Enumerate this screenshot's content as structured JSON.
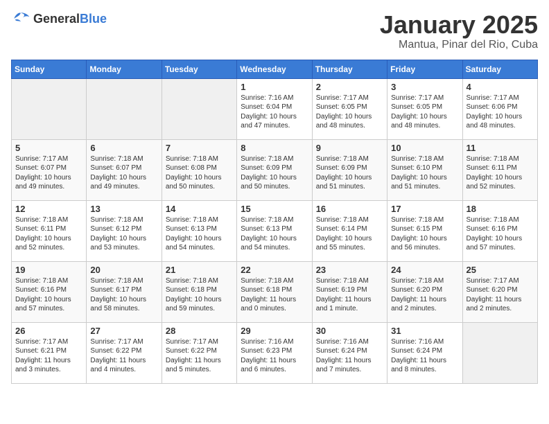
{
  "header": {
    "logo_general": "General",
    "logo_blue": "Blue",
    "month": "January 2025",
    "location": "Mantua, Pinar del Rio, Cuba"
  },
  "days_of_week": [
    "Sunday",
    "Monday",
    "Tuesday",
    "Wednesday",
    "Thursday",
    "Friday",
    "Saturday"
  ],
  "weeks": [
    [
      {
        "day": "",
        "empty": true
      },
      {
        "day": "",
        "empty": true
      },
      {
        "day": "",
        "empty": true
      },
      {
        "day": "1",
        "sunrise": "Sunrise: 7:16 AM",
        "sunset": "Sunset: 6:04 PM",
        "daylight": "Daylight: 10 hours and 47 minutes."
      },
      {
        "day": "2",
        "sunrise": "Sunrise: 7:17 AM",
        "sunset": "Sunset: 6:05 PM",
        "daylight": "Daylight: 10 hours and 48 minutes."
      },
      {
        "day": "3",
        "sunrise": "Sunrise: 7:17 AM",
        "sunset": "Sunset: 6:05 PM",
        "daylight": "Daylight: 10 hours and 48 minutes."
      },
      {
        "day": "4",
        "sunrise": "Sunrise: 7:17 AM",
        "sunset": "Sunset: 6:06 PM",
        "daylight": "Daylight: 10 hours and 48 minutes."
      }
    ],
    [
      {
        "day": "5",
        "sunrise": "Sunrise: 7:17 AM",
        "sunset": "Sunset: 6:07 PM",
        "daylight": "Daylight: 10 hours and 49 minutes."
      },
      {
        "day": "6",
        "sunrise": "Sunrise: 7:18 AM",
        "sunset": "Sunset: 6:07 PM",
        "daylight": "Daylight: 10 hours and 49 minutes."
      },
      {
        "day": "7",
        "sunrise": "Sunrise: 7:18 AM",
        "sunset": "Sunset: 6:08 PM",
        "daylight": "Daylight: 10 hours and 50 minutes."
      },
      {
        "day": "8",
        "sunrise": "Sunrise: 7:18 AM",
        "sunset": "Sunset: 6:09 PM",
        "daylight": "Daylight: 10 hours and 50 minutes."
      },
      {
        "day": "9",
        "sunrise": "Sunrise: 7:18 AM",
        "sunset": "Sunset: 6:09 PM",
        "daylight": "Daylight: 10 hours and 51 minutes."
      },
      {
        "day": "10",
        "sunrise": "Sunrise: 7:18 AM",
        "sunset": "Sunset: 6:10 PM",
        "daylight": "Daylight: 10 hours and 51 minutes."
      },
      {
        "day": "11",
        "sunrise": "Sunrise: 7:18 AM",
        "sunset": "Sunset: 6:11 PM",
        "daylight": "Daylight: 10 hours and 52 minutes."
      }
    ],
    [
      {
        "day": "12",
        "sunrise": "Sunrise: 7:18 AM",
        "sunset": "Sunset: 6:11 PM",
        "daylight": "Daylight: 10 hours and 52 minutes."
      },
      {
        "day": "13",
        "sunrise": "Sunrise: 7:18 AM",
        "sunset": "Sunset: 6:12 PM",
        "daylight": "Daylight: 10 hours and 53 minutes."
      },
      {
        "day": "14",
        "sunrise": "Sunrise: 7:18 AM",
        "sunset": "Sunset: 6:13 PM",
        "daylight": "Daylight: 10 hours and 54 minutes."
      },
      {
        "day": "15",
        "sunrise": "Sunrise: 7:18 AM",
        "sunset": "Sunset: 6:13 PM",
        "daylight": "Daylight: 10 hours and 54 minutes."
      },
      {
        "day": "16",
        "sunrise": "Sunrise: 7:18 AM",
        "sunset": "Sunset: 6:14 PM",
        "daylight": "Daylight: 10 hours and 55 minutes."
      },
      {
        "day": "17",
        "sunrise": "Sunrise: 7:18 AM",
        "sunset": "Sunset: 6:15 PM",
        "daylight": "Daylight: 10 hours and 56 minutes."
      },
      {
        "day": "18",
        "sunrise": "Sunrise: 7:18 AM",
        "sunset": "Sunset: 6:16 PM",
        "daylight": "Daylight: 10 hours and 57 minutes."
      }
    ],
    [
      {
        "day": "19",
        "sunrise": "Sunrise: 7:18 AM",
        "sunset": "Sunset: 6:16 PM",
        "daylight": "Daylight: 10 hours and 57 minutes."
      },
      {
        "day": "20",
        "sunrise": "Sunrise: 7:18 AM",
        "sunset": "Sunset: 6:17 PM",
        "daylight": "Daylight: 10 hours and 58 minutes."
      },
      {
        "day": "21",
        "sunrise": "Sunrise: 7:18 AM",
        "sunset": "Sunset: 6:18 PM",
        "daylight": "Daylight: 10 hours and 59 minutes."
      },
      {
        "day": "22",
        "sunrise": "Sunrise: 7:18 AM",
        "sunset": "Sunset: 6:18 PM",
        "daylight": "Daylight: 11 hours and 0 minutes."
      },
      {
        "day": "23",
        "sunrise": "Sunrise: 7:18 AM",
        "sunset": "Sunset: 6:19 PM",
        "daylight": "Daylight: 11 hours and 1 minute."
      },
      {
        "day": "24",
        "sunrise": "Sunrise: 7:18 AM",
        "sunset": "Sunset: 6:20 PM",
        "daylight": "Daylight: 11 hours and 2 minutes."
      },
      {
        "day": "25",
        "sunrise": "Sunrise: 7:17 AM",
        "sunset": "Sunset: 6:20 PM",
        "daylight": "Daylight: 11 hours and 2 minutes."
      }
    ],
    [
      {
        "day": "26",
        "sunrise": "Sunrise: 7:17 AM",
        "sunset": "Sunset: 6:21 PM",
        "daylight": "Daylight: 11 hours and 3 minutes."
      },
      {
        "day": "27",
        "sunrise": "Sunrise: 7:17 AM",
        "sunset": "Sunset: 6:22 PM",
        "daylight": "Daylight: 11 hours and 4 minutes."
      },
      {
        "day": "28",
        "sunrise": "Sunrise: 7:17 AM",
        "sunset": "Sunset: 6:22 PM",
        "daylight": "Daylight: 11 hours and 5 minutes."
      },
      {
        "day": "29",
        "sunrise": "Sunrise: 7:16 AM",
        "sunset": "Sunset: 6:23 PM",
        "daylight": "Daylight: 11 hours and 6 minutes."
      },
      {
        "day": "30",
        "sunrise": "Sunrise: 7:16 AM",
        "sunset": "Sunset: 6:24 PM",
        "daylight": "Daylight: 11 hours and 7 minutes."
      },
      {
        "day": "31",
        "sunrise": "Sunrise: 7:16 AM",
        "sunset": "Sunset: 6:24 PM",
        "daylight": "Daylight: 11 hours and 8 minutes."
      },
      {
        "day": "",
        "empty": true
      }
    ]
  ]
}
